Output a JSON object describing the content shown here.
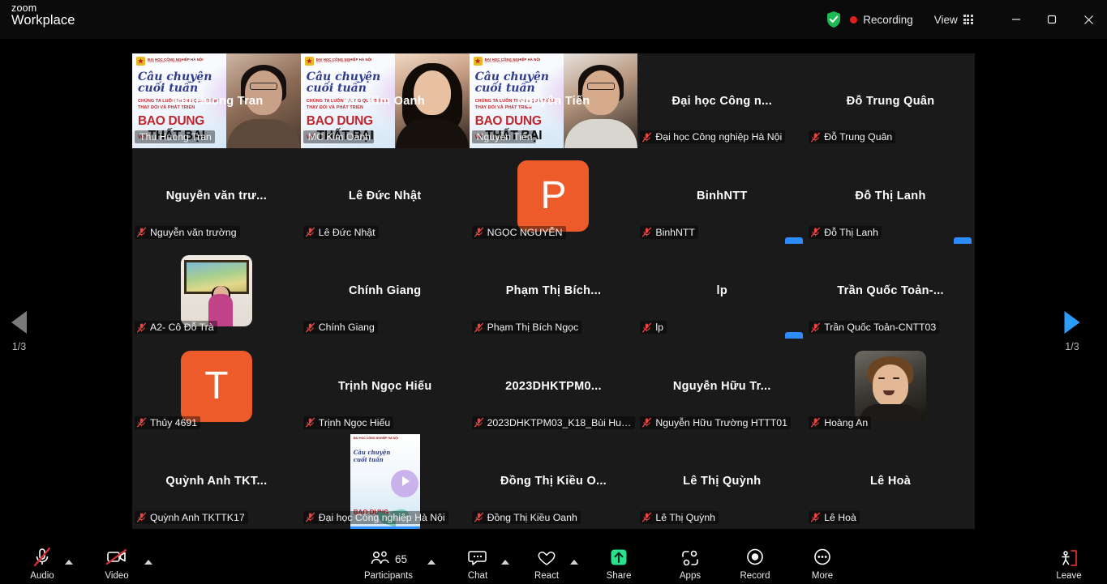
{
  "titlebar": {
    "brand_zoom": "zoom",
    "brand_product": "Workplace",
    "encryption_icon": "shield-check-icon",
    "recording_label": "Recording",
    "view_label": "View",
    "view_icon": "grid-icon",
    "minimize_icon": "minimize-icon",
    "maximize_icon": "restore-icon",
    "close_icon": "close-icon"
  },
  "slide": {
    "logo_title": "ĐẠI HỌC CÔNG NGHIỆP HÀ NỘI",
    "logo_sub": "HANOI UNIVERSITY OF INDUSTRY",
    "title_line1": "Câu chuyện",
    "title_line2": "cuối tuần",
    "sub_line1": "CHÚNG TA LUÔN TRONG QUÁ TRÌNH",
    "sub_line2": "THAY ĐỔI VÀ PHÁT TRIỂN",
    "big1": "BAO DUNG",
    "big2_small": "VỚI",
    "big2": "THẤT BẠI"
  },
  "gallery": {
    "page_prev_label": "1/3",
    "page_next_label": "1/3",
    "prev_icon": "triangle-left-icon",
    "next_icon": "triangle-right-icon",
    "mic_icon": "mic-muted-icon",
    "more_badge_label": "···",
    "tiles": [
      {
        "name": "Thu Huong Tran",
        "footer": "Thu Huong Tran",
        "kind": "video",
        "cam": "a",
        "active": false,
        "muted": false
      },
      {
        "name": "MC Kim Oanh",
        "footer": "MC Kim Oanh",
        "kind": "video",
        "cam": "b",
        "active": true,
        "muted": false
      },
      {
        "name": "Nguyễn Tiến",
        "footer": "Nguyễn Tiến",
        "kind": "video",
        "cam": "c",
        "active": false,
        "muted": false
      },
      {
        "name": "Đại học Công n...",
        "footer": "Đại học Công nghiệp Hà Nội",
        "kind": "name",
        "muted": true
      },
      {
        "name": "Đỗ Trung Quân",
        "footer": "Đỗ Trung Quân",
        "kind": "name",
        "muted": true
      },
      {
        "name": "Nguyễn văn trư...",
        "footer": "Nguyễn văn trường",
        "kind": "name",
        "muted": true
      },
      {
        "name": "Lê Đức Nhật",
        "footer": "Lê Đức Nhật",
        "kind": "name",
        "muted": true
      },
      {
        "name": "",
        "footer": "NGỌC NGUYỄN",
        "kind": "avatar",
        "avatar_letter": "P",
        "muted": true
      },
      {
        "name": "BinhNTT",
        "footer": "BinhNTT",
        "kind": "name",
        "muted": true,
        "more": true
      },
      {
        "name": "Đỗ Thị Lanh",
        "footer": "Đỗ Thị Lanh",
        "kind": "name",
        "muted": true,
        "more": true
      },
      {
        "name": "",
        "footer": "A2- Cô Đỗ Trà",
        "kind": "photo",
        "photo": "tra",
        "muted": true
      },
      {
        "name": "Chính Giang",
        "footer": "Chính Giang",
        "kind": "name",
        "muted": true
      },
      {
        "name": "Phạm Thị Bích...",
        "footer": "Phạm Thị Bích Ngọc",
        "kind": "name",
        "muted": true
      },
      {
        "name": "lp",
        "footer": "lp",
        "kind": "name",
        "muted": true,
        "more": true
      },
      {
        "name": "Trần Quốc Toản-...",
        "footer": "Trần Quốc Toản-CNTT03",
        "kind": "name",
        "muted": true
      },
      {
        "name": "",
        "footer": "Thủy 4691",
        "kind": "avatar",
        "avatar_letter": "T",
        "muted": true
      },
      {
        "name": "Trịnh Ngọc Hiếu",
        "footer": "Trịnh Ngọc Hiếu",
        "kind": "name",
        "muted": true
      },
      {
        "name": "2023DHKTPM0...",
        "footer": "2023DHKTPM03_K18_Bùi Huy ...",
        "kind": "name",
        "muted": true
      },
      {
        "name": "Nguyễn Hữu Tr...",
        "footer": "Nguyễn Hữu Trường HTTT01",
        "kind": "name",
        "muted": true
      },
      {
        "name": "",
        "footer": "Hoàng An",
        "kind": "photo",
        "photo": "an",
        "muted": true
      },
      {
        "name": "Quỳnh Anh TKT...",
        "footer": "Quỳnh Anh TKTTK17",
        "kind": "name",
        "muted": true
      },
      {
        "name": "",
        "footer": "Đại học Công nghiệp Hà Nội",
        "kind": "poster",
        "muted": true
      },
      {
        "name": "Đồng Thị Kiều O...",
        "footer": "Đồng Thị Kiều Oanh",
        "kind": "name",
        "muted": true
      },
      {
        "name": "Lê Thị Quỳnh",
        "footer": "Lê Thị Quỳnh",
        "kind": "name",
        "muted": true
      },
      {
        "name": "Lê Hoà",
        "footer": "Lê Hoà",
        "kind": "name",
        "muted": true
      }
    ]
  },
  "toolbar": {
    "audio_label": "Audio",
    "audio_icon": "mic-muted-icon",
    "video_label": "Video",
    "video_icon": "camera-off-icon",
    "participants_label": "Participants",
    "participants_count": "65",
    "participants_icon": "people-icon",
    "chat_label": "Chat",
    "chat_icon": "chat-bubble-icon",
    "react_label": "React",
    "react_icon": "heart-icon",
    "share_label": "Share",
    "share_icon": "share-screen-icon",
    "apps_label": "Apps",
    "apps_icon": "apps-icon",
    "record_label": "Record",
    "record_icon": "record-circle-icon",
    "more_label": "More",
    "more_icon": "ellipsis-circle-icon",
    "leave_label": "Leave",
    "leave_icon": "leave-door-icon"
  },
  "colors": {
    "accent_blue": "#2d8cff",
    "share_green": "#2bd98c",
    "leave_red": "#e02d2d",
    "avatar_orange": "#ee5b2b",
    "mute_red": "#e8443f"
  }
}
